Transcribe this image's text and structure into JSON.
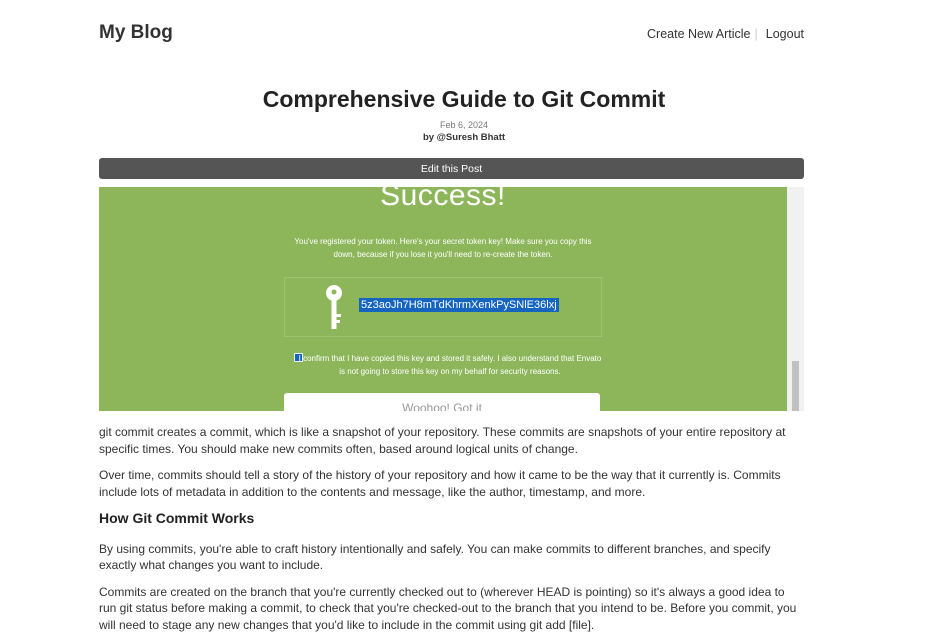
{
  "header": {
    "brand": "My Blog",
    "nav": {
      "create": "Create New Article",
      "logout": "Logout"
    }
  },
  "post": {
    "title": "Comprehensive Guide to Git Commit",
    "date": "Feb 6, 2024",
    "author": "by @Suresh Bhatt",
    "edit_label": "Edit this Post",
    "image": {
      "heading": "Success!",
      "info": "You've registered your token. Here's your secret token key! Make sure you copy this down, because if you lose it you'll need to re-create the token.",
      "token": "5z3aoJh7H8mTdKhrmXenkPySNlE36lxj",
      "confirm": "I confirm that I have copied this key and stored it safely. I also understand that Envato is not going to store this key on my behalf for security reasons.",
      "button": "Woohoo! Got it",
      "bg_color": "#8db65b"
    },
    "paragraphs": [
      "git commit creates a commit, which is like a snapshot of your repository. These commits are snapshots of your entire repository at specific times. You should make new commits often, based around logical units of change.",
      "Over time, commits should tell a story of the history of your repository and how it came to be the way that it currently is. Commits include lots of metadata in addition to the contents and message, like the author, timestamp, and more."
    ],
    "subheading": "How Git Commit Works",
    "paragraphs2": [
      "By using commits, you're able to craft history intentionally and safely. You can make commits to different branches, and specify exactly what changes you want to include.",
      "Commits are created on the branch that you're currently checked out to (wherever HEAD is pointing) so it's always a good idea to run git status before making a commit, to check that you're checked-out to the branch that you intend to be. Before you commit, you will need to stage any new changes that you'd like to include in the commit using git add [file]."
    ]
  }
}
